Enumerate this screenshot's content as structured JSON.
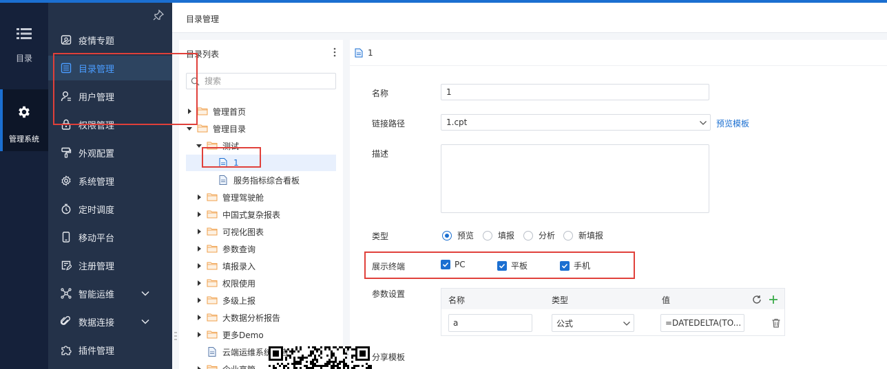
{
  "rail": {
    "items": [
      {
        "label": "目录",
        "icon": "list-icon"
      },
      {
        "label": "管理系统",
        "icon": "gear-icon"
      }
    ]
  },
  "menu": {
    "items": [
      {
        "label": "疫情专题",
        "icon": "picture-icon"
      },
      {
        "label": "目录管理",
        "icon": "catalog-icon",
        "active": true
      },
      {
        "label": "用户管理",
        "icon": "user-icon"
      },
      {
        "label": "权限管理",
        "icon": "lock-icon"
      },
      {
        "label": "外观配置",
        "icon": "paint-brush-icon"
      },
      {
        "label": "系统管理",
        "icon": "gear-icon"
      },
      {
        "label": "定时调度",
        "icon": "timer-icon"
      },
      {
        "label": "移动平台",
        "icon": "mobile-icon"
      },
      {
        "label": "注册管理",
        "icon": "register-icon"
      },
      {
        "label": "智能运维",
        "icon": "network-icon",
        "expandable": true
      },
      {
        "label": "数据连接",
        "icon": "link-icon",
        "expandable": true
      },
      {
        "label": "插件管理",
        "icon": "puzzle-icon"
      }
    ]
  },
  "breadcrumb": {
    "title": "目录管理"
  },
  "tree": {
    "title": "目录列表",
    "search_placeholder": "搜索",
    "items": [
      {
        "label": "管理首页",
        "type": "folder",
        "state": "collapsed",
        "level": 0
      },
      {
        "label": "管理目录",
        "type": "folder",
        "state": "expanded",
        "level": 0
      },
      {
        "label": "测试",
        "type": "folder",
        "state": "expanded",
        "level": 1
      },
      {
        "label": "1",
        "type": "file",
        "level": 2,
        "selected": true
      },
      {
        "label": "服务指标综合看板",
        "type": "file",
        "level": 2
      },
      {
        "label": "管理驾驶舱",
        "type": "folder",
        "state": "collapsed",
        "level": 1
      },
      {
        "label": "中国式复杂报表",
        "type": "folder",
        "state": "collapsed",
        "level": 1
      },
      {
        "label": "可视化图表",
        "type": "folder",
        "state": "collapsed",
        "level": 1
      },
      {
        "label": "参数查询",
        "type": "folder",
        "state": "collapsed",
        "level": 1
      },
      {
        "label": "填报录入",
        "type": "folder",
        "state": "collapsed",
        "level": 1
      },
      {
        "label": "权限使用",
        "type": "folder",
        "state": "collapsed",
        "level": 1
      },
      {
        "label": "多级上报",
        "type": "folder",
        "state": "collapsed",
        "level": 1
      },
      {
        "label": "大数据分析报告",
        "type": "folder",
        "state": "collapsed",
        "level": 1
      },
      {
        "label": "更多Demo",
        "type": "folder",
        "state": "collapsed",
        "level": 1
      },
      {
        "label": "云端运维系统报告",
        "type": "file",
        "level": 1
      },
      {
        "label": "企业高管",
        "type": "folder",
        "state": "collapsed",
        "level": 1
      }
    ]
  },
  "detail": {
    "header": "1",
    "name_label": "名称",
    "name_value": "1",
    "path_label": "链接路径",
    "path_value": "1.cpt",
    "preview_link": "预览模板",
    "desc_label": "描述",
    "type_label": "类型",
    "type_options": [
      "预览",
      "填报",
      "分析",
      "新填报"
    ],
    "type_selected": "预览",
    "terminal_label": "展示终端",
    "terminals": [
      {
        "label": "PC",
        "checked": true
      },
      {
        "label": "平板",
        "checked": true
      },
      {
        "label": "手机",
        "checked": true
      }
    ],
    "param_label": "参数设置",
    "param_headers": [
      "名称",
      "类型",
      "值"
    ],
    "param_row": {
      "name": "a",
      "type": "公式",
      "value": "=DATEDELTA(TO..."
    },
    "share_label": "分享模板"
  },
  "colors": {
    "accent": "#1b6fd1",
    "menu_bg": "#243249",
    "rail_bg": "#15213a",
    "highlight": "#e0403a",
    "folder": "#f0a04b"
  }
}
